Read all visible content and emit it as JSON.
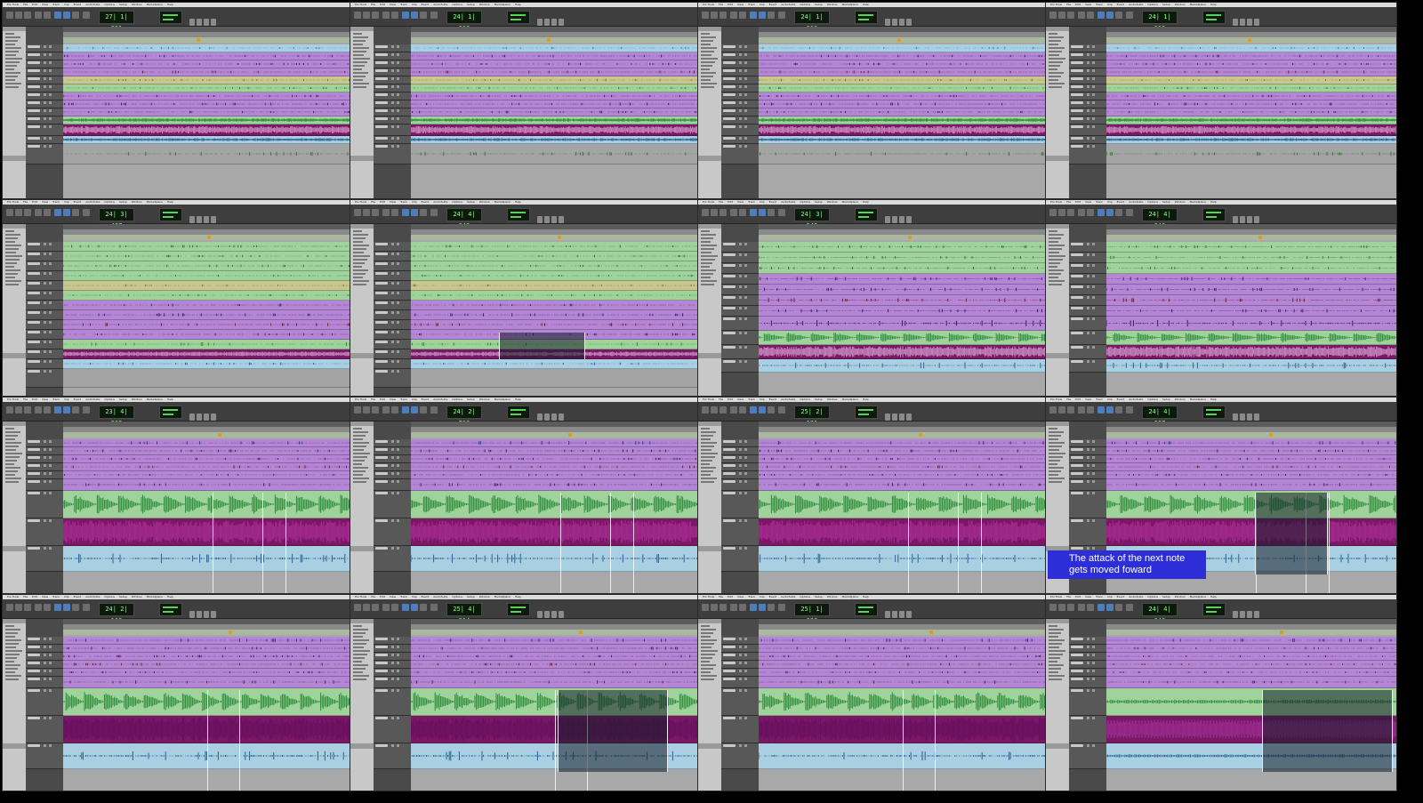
{
  "app": {
    "menu": [
      "Pro Tools",
      "File",
      "Edit",
      "View",
      "Track",
      "Clip",
      "Event",
      "AudioSuite",
      "Options",
      "Setup",
      "Window",
      "Marketplace",
      "Help"
    ]
  },
  "colors": {
    "cyan": "#8ec9d8",
    "purple": "#b585d6",
    "magenta": "#7a1865",
    "green": "#3fa347",
    "lightgreen": "#9fd39b",
    "yellow": "#c9c78e",
    "blue": "#a9cfe3",
    "darkblue": "#2c5f8e",
    "darkpurple": "#4a2a6f",
    "darkred": "#8a1a1a",
    "caption_bg": "#2e2ed8"
  },
  "frames": [
    {
      "counter": "27| 1| 831",
      "layout": "full"
    },
    {
      "counter": "24| 1| 019",
      "layout": "full"
    },
    {
      "counter": "24| 1| 019",
      "layout": "full"
    },
    {
      "counter": "24| 1| 019",
      "layout": "full"
    },
    {
      "counter": "24| 3| 487",
      "layout": "zoom1"
    },
    {
      "counter": "24| 4| 843",
      "layout": "zoom1sel"
    },
    {
      "counter": "24| 3| 543",
      "layout": "zoom2"
    },
    {
      "counter": "24| 4| 846",
      "layout": "zoom2"
    },
    {
      "counter": "23| 4| 802",
      "layout": "zoom3"
    },
    {
      "counter": "24| 2| 713",
      "layout": "zoom3"
    },
    {
      "counter": "25| 2| 191",
      "layout": "zoom3"
    },
    {
      "counter": "24| 4| 867",
      "layout": "zoom3cap",
      "caption": "The attack of the next note gets moved foward"
    },
    {
      "counter": "24| 2| 100",
      "layout": "zoom4"
    },
    {
      "counter": "25| 4| 914",
      "layout": "zoom4sel"
    },
    {
      "counter": "25| 1| 098",
      "layout": "zoom4"
    },
    {
      "counter": "24| 4| 846",
      "layout": "zoom5sel"
    }
  ]
}
